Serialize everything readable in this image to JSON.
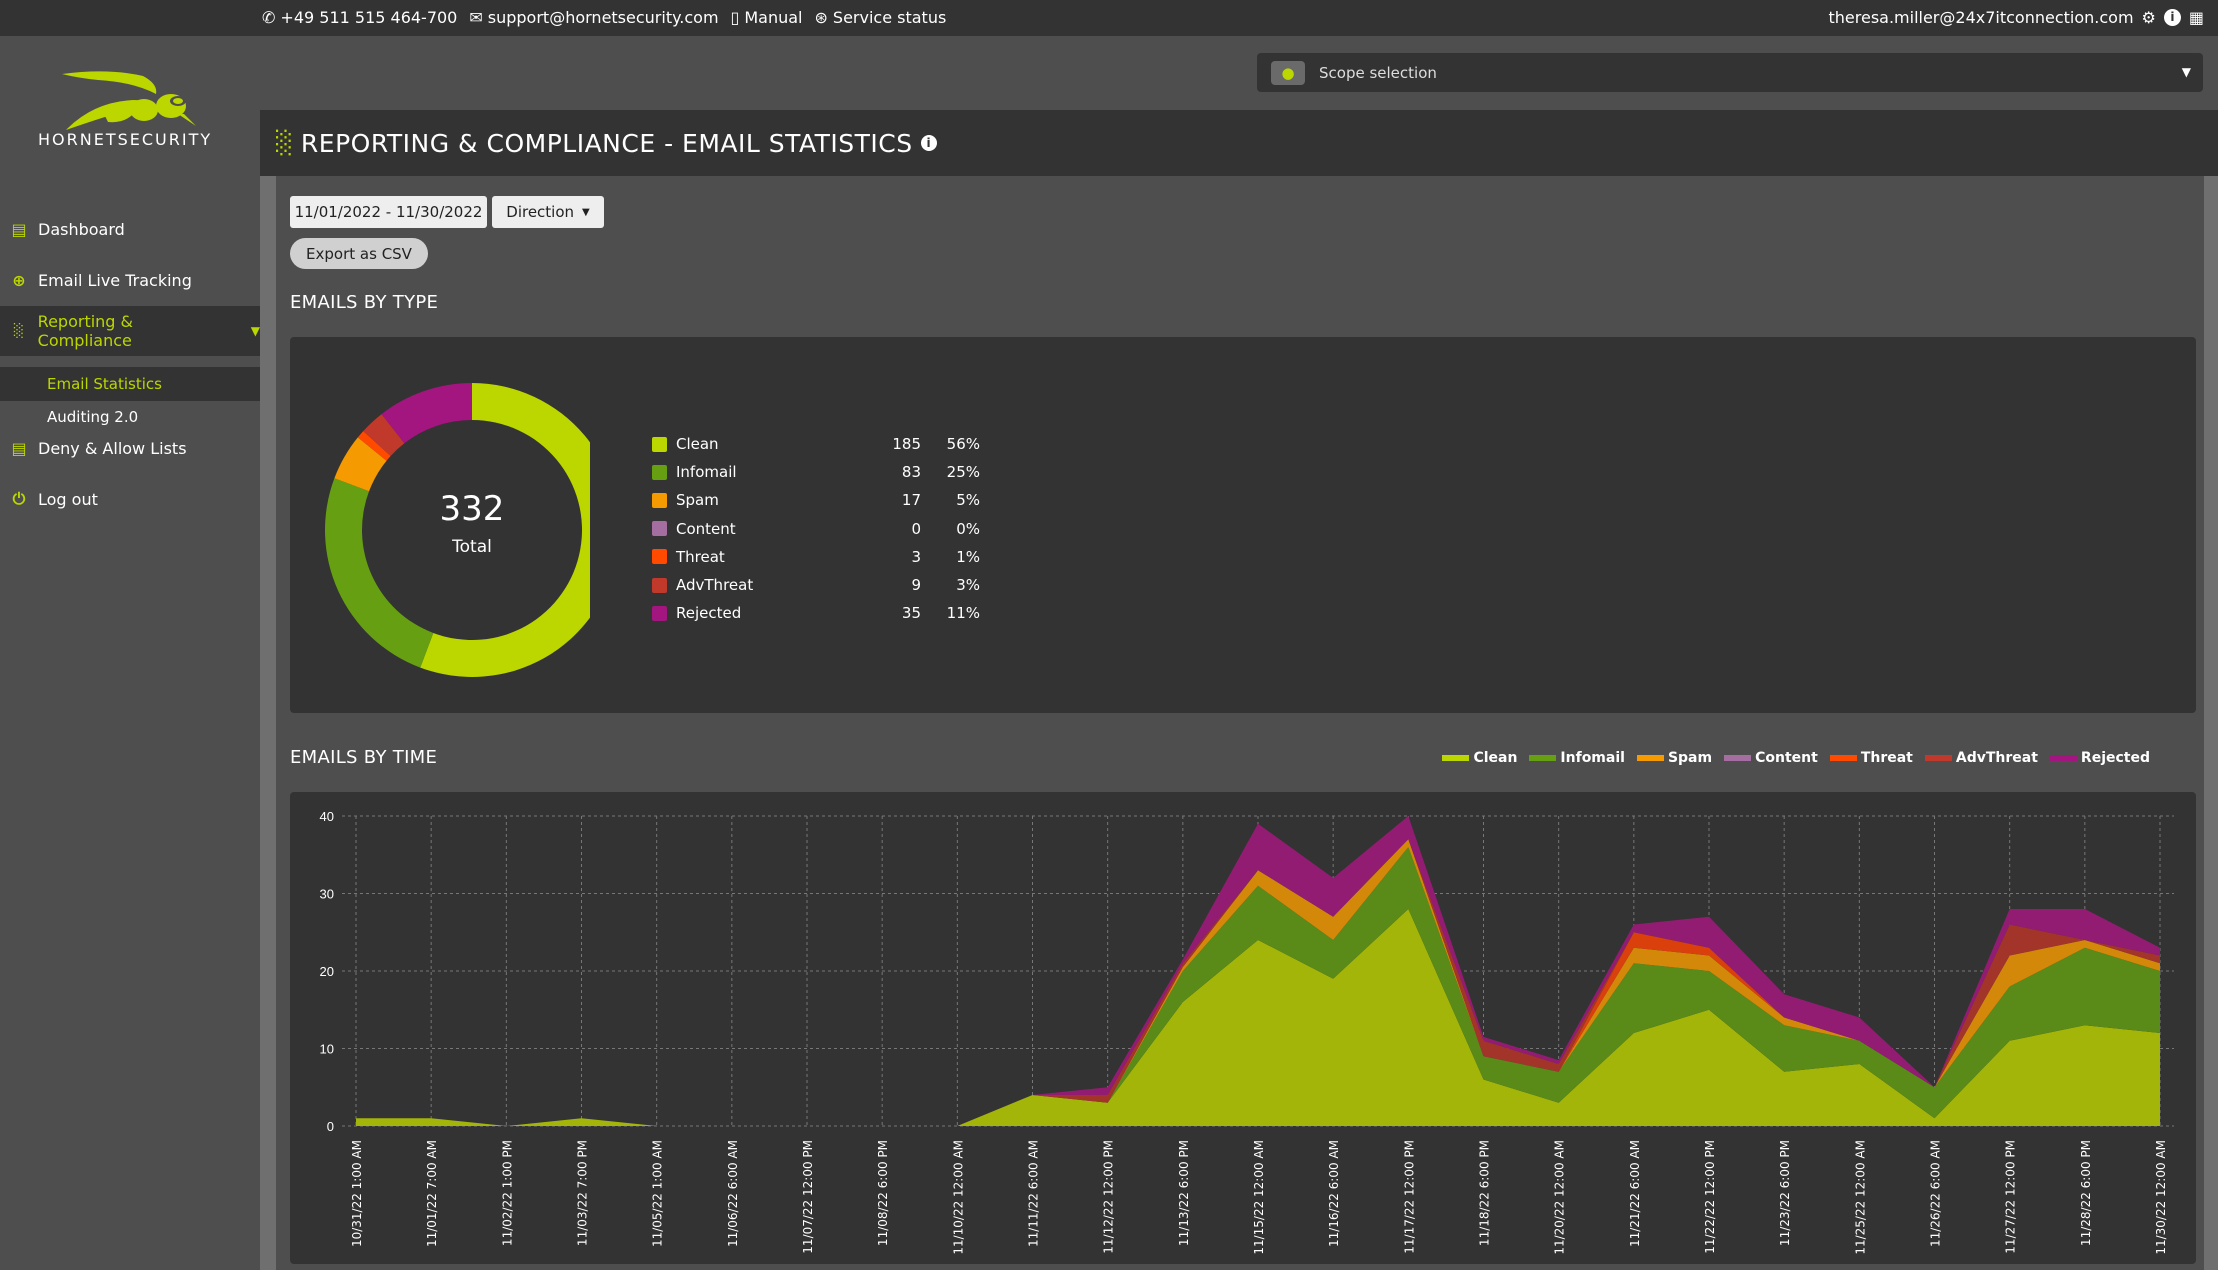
{
  "topbar": {
    "phone": "+49 511 515 464-700",
    "email": "support@hornetsecurity.com",
    "manual": "Manual",
    "service_status": "Service status",
    "user_email": "theresa.miller@24x7itconnection.com"
  },
  "brand": {
    "name": "HORNETSECURITY",
    "accent": "#bcd600"
  },
  "sidebar": {
    "items": [
      {
        "label": "Dashboard",
        "icon": "list-icon"
      },
      {
        "label": "Email Live Tracking",
        "icon": "search-plus-icon"
      },
      {
        "label": "Reporting & Compliance",
        "icon": "bar-chart-icon",
        "active": true
      },
      {
        "label": "Deny & Allow Lists",
        "icon": "list-icon"
      },
      {
        "label": "Log out",
        "icon": "power-icon"
      }
    ],
    "subitems": [
      {
        "label": "Email Statistics",
        "active": true
      },
      {
        "label": "Auditing 2.0"
      }
    ]
  },
  "scope": {
    "label": "Scope selection"
  },
  "header": {
    "title": "REPORTING & COMPLIANCE - EMAIL STATISTICS"
  },
  "filters": {
    "date_range": "11/01/2022 - 11/30/2022",
    "direction": "Direction",
    "export": "Export as CSV"
  },
  "by_type": {
    "title": "EMAILS BY TYPE",
    "total": "332",
    "total_label": "Total"
  },
  "by_time": {
    "title": "EMAILS BY TIME"
  },
  "chart_data": [
    {
      "type": "pie",
      "title": "EMAILS BY TYPE",
      "center_value": 332,
      "center_label": "Total",
      "categories": [
        "Clean",
        "Infomail",
        "Spam",
        "Content",
        "Threat",
        "AdvThreat",
        "Rejected"
      ],
      "values": [
        185,
        83,
        17,
        0,
        3,
        9,
        35
      ],
      "percents": [
        "56%",
        "25%",
        "5%",
        "0%",
        "1%",
        "3%",
        "11%"
      ],
      "colors": [
        "#bcd600",
        "#66a012",
        "#f59a00",
        "#a56ea0",
        "#ff4a00",
        "#c0392b",
        "#a3157f"
      ],
      "legend": "right"
    },
    {
      "type": "area",
      "stacked": true,
      "title": "EMAILS BY TIME",
      "xlabel": "",
      "ylabel": "",
      "ylim": [
        0,
        40
      ],
      "yticks": [
        0,
        10,
        20,
        30,
        40
      ],
      "grid": true,
      "legend": "top-right",
      "x": [
        "10/31/22 1:00 AM",
        "11/01/22 7:00 AM",
        "11/02/22 1:00 PM",
        "11/03/22 7:00 PM",
        "11/05/22 1:00 AM",
        "11/06/22 6:00 AM",
        "11/07/22 12:00 PM",
        "11/08/22 6:00 PM",
        "11/10/22 12:00 AM",
        "11/11/22 6:00 AM",
        "11/12/22 12:00 PM",
        "11/13/22 6:00 PM",
        "11/15/22 12:00 AM",
        "11/16/22 6:00 AM",
        "11/17/22 12:00 PM",
        "11/18/22 6:00 PM",
        "11/20/22 12:00 AM",
        "11/21/22 6:00 AM",
        "11/22/22 12:00 PM",
        "11/23/22 6:00 PM",
        "11/25/22 12:00 AM",
        "11/26/22 6:00 AM",
        "11/27/22 12:00 PM",
        "11/28/22 6:00 PM",
        "11/30/22 12:00 AM"
      ],
      "series": [
        {
          "name": "Clean",
          "color": "#a4b50a",
          "values": [
            1,
            1,
            0,
            1,
            0,
            0,
            0,
            0,
            0,
            4,
            3,
            16,
            24,
            19,
            28,
            6,
            3,
            12,
            15,
            7,
            8,
            1,
            11,
            13,
            12
          ]
        },
        {
          "name": "Infomail",
          "color": "#5a8a18",
          "values": [
            0,
            0,
            0,
            0,
            0,
            0,
            0,
            0,
            0,
            0,
            0,
            4,
            7,
            5,
            8,
            3,
            4,
            9,
            5,
            6,
            3,
            4,
            7,
            10,
            8
          ]
        },
        {
          "name": "Spam",
          "color": "#d4880a",
          "values": [
            0,
            0,
            0,
            0,
            0,
            0,
            0,
            0,
            0,
            0,
            0,
            0.5,
            2,
            3,
            1,
            0,
            0,
            2,
            2,
            1,
            0,
            0,
            4,
            1,
            1
          ]
        },
        {
          "name": "Content",
          "color": "#a56ea0",
          "values": [
            0,
            0,
            0,
            0,
            0,
            0,
            0,
            0,
            0,
            0,
            0,
            0,
            0,
            0,
            0,
            0,
            0,
            0,
            0,
            0,
            0,
            0,
            0,
            0,
            0
          ]
        },
        {
          "name": "Threat",
          "color": "#d9400c",
          "values": [
            0,
            0,
            0,
            0,
            0,
            0,
            0,
            0,
            0,
            0,
            0,
            0,
            0,
            0,
            0,
            0,
            0,
            2,
            1,
            0,
            0,
            0,
            0,
            0,
            0
          ]
        },
        {
          "name": "AdvThreat",
          "color": "#a3342a",
          "values": [
            0,
            0,
            0,
            0,
            0,
            0,
            0,
            0,
            0,
            0,
            1,
            0.5,
            0,
            0,
            0,
            2,
            1,
            0,
            0,
            0,
            0,
            0,
            4,
            0,
            1
          ]
        },
        {
          "name": "Rejected",
          "color": "#931c73",
          "values": [
            0,
            0,
            0,
            0,
            0,
            0,
            0,
            0,
            0,
            0,
            1,
            0.5,
            6,
            5,
            3,
            0.5,
            0.5,
            1,
            4,
            3,
            3,
            0,
            2,
            4,
            1
          ]
        }
      ],
      "legend_colors": [
        "#bcd600",
        "#66a012",
        "#f59a00",
        "#a56ea0",
        "#ff4a00",
        "#c0392b",
        "#a3157f"
      ]
    }
  ]
}
